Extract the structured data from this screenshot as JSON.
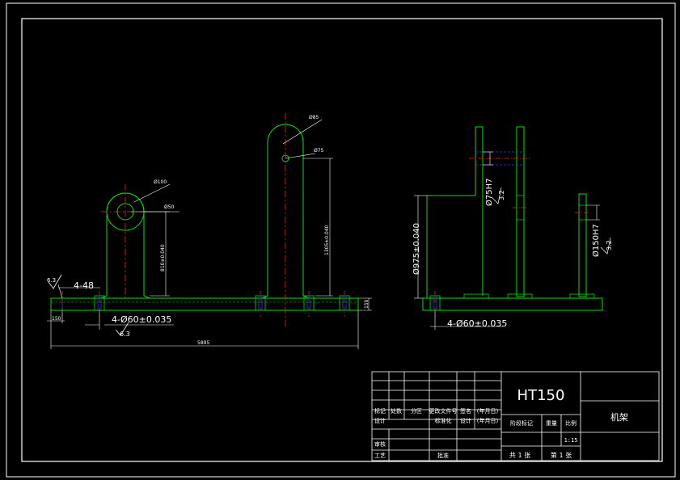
{
  "colors": {
    "background": "#000000",
    "frame": "#ffffff",
    "part_outline": "#00e000",
    "centerline": "#ff2020",
    "hidden_line": "#2040ff",
    "dimension": "#ffffff"
  },
  "front_view": {
    "small_lug_outer_dia": "Ø100",
    "small_lug_hole_dia": "Ø50",
    "small_lug_center_height": "810±0.040",
    "large_lug_outer_dia": "Ø85",
    "large_lug_hole_dia": "Ø75",
    "large_lug_center_height": "1305±0.040",
    "base_thickness": "150",
    "left_edge_dim": "150",
    "overall_length": "5895",
    "left_hole_callout": "4-48",
    "bolt_holes_callout": "4-Ø60±0.035",
    "roughness": "6.3"
  },
  "side_view": {
    "left_height_dim": "Ø975±0.040",
    "upper_bore_fit": "Ø75H7",
    "upper_bore_roughness": "3.2",
    "lower_bore_fit": "Ø150H7",
    "lower_bore_roughness": "3.2",
    "bolt_holes_callout": "4-Ø60±0.035"
  },
  "title_block": {
    "material": "HT150",
    "part_name": "机架",
    "header_labels": [
      "标记",
      "处数",
      "分区",
      "更改文件号",
      "签名",
      "(年月日)"
    ],
    "row_design": [
      "设计",
      "标准化",
      "设计",
      "(年月日)"
    ],
    "stage_mark": "阶段标记",
    "weight": "重量",
    "scale_label": "比例",
    "scale_value": "1:15",
    "review": "审核",
    "process": "工艺",
    "approve": "批准",
    "sheets_total": "共 1 张",
    "sheet_no": "第 1 张"
  }
}
